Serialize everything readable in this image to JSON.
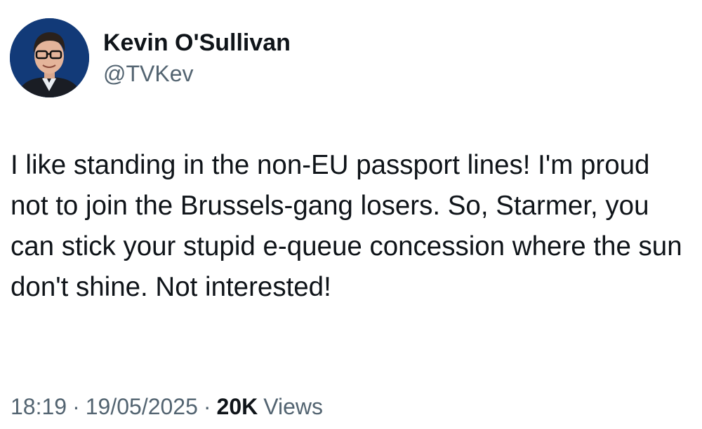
{
  "author": {
    "display_name": "Kevin O'Sullivan",
    "handle": "@TVKev"
  },
  "tweet": {
    "text": "I like standing in the non-EU passport lines! I'm proud not to join the Brussels-gang losers. So, Starmer, you can stick your stupid e-queue concession where the sun don't shine. Not interested!",
    "time": "18:19",
    "separator": "·",
    "date": "19/05/2025",
    "views_count": "20K",
    "views_label": "Views"
  }
}
